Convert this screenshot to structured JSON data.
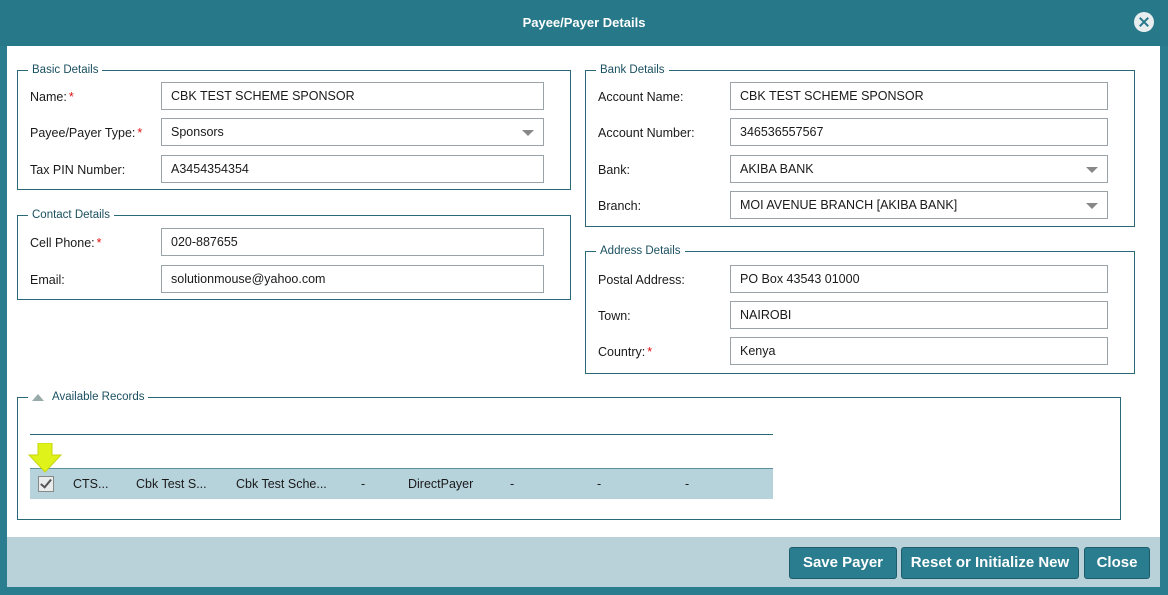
{
  "window": {
    "title": "Payee/Payer Details"
  },
  "basic_details": {
    "legend": "Basic Details",
    "name_label": "Name:",
    "name_value": "CBK TEST SCHEME SPONSOR",
    "type_label": "Payee/Payer Type:",
    "type_value": "Sponsors",
    "tax_label": "Tax PIN Number:",
    "tax_value": "A3454354354"
  },
  "contact_details": {
    "legend": "Contact Details",
    "cell_label": "Cell Phone:",
    "cell_value": "020-887655",
    "email_label": "Email:",
    "email_value": "solutionmouse@yahoo.com"
  },
  "bank_details": {
    "legend": "Bank Details",
    "account_name_label": "Account Name:",
    "account_name_value": "CBK TEST SCHEME SPONSOR",
    "account_number_label": "Account Number:",
    "account_number_value": "346536557567",
    "bank_label": "Bank:",
    "bank_value": "AKIBA BANK",
    "branch_label": "Branch:",
    "branch_value": "MOI AVENUE BRANCH [AKIBA BANK]"
  },
  "address_details": {
    "legend": "Address Details",
    "postal_label": "Postal Address:",
    "postal_value": "PO Box 43543 01000",
    "town_label": "Town:",
    "town_value": "NAIROBI",
    "country_label": "Country:",
    "country_value": "Kenya"
  },
  "records": {
    "legend": "Available Records",
    "row": [
      "CTS...",
      "Cbk Test S...",
      "Cbk Test Sche...",
      "-",
      "DirectPayer",
      "-",
      "-",
      "-"
    ]
  },
  "required_mark": "*",
  "buttons": {
    "save": "Save Payer",
    "reset": "Reset or Initialize New",
    "close": "Close"
  },
  "colors": {
    "header": "#27798a",
    "footer": "#b9d2d9",
    "selected_row": "#b6d3dc",
    "highlight_arrow": "#dff21a"
  }
}
